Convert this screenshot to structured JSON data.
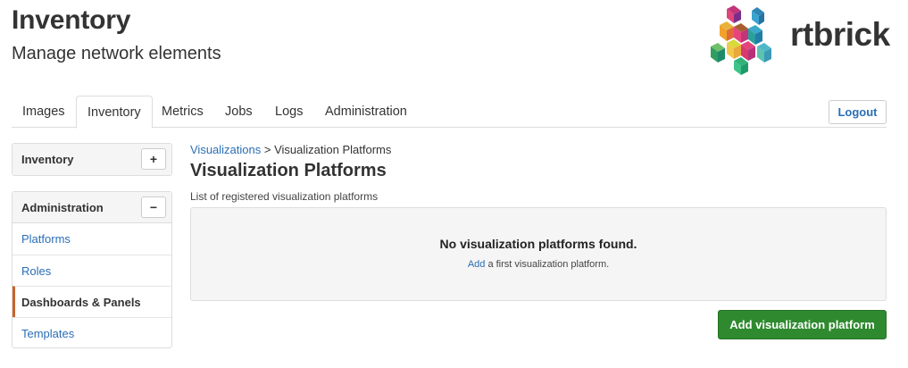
{
  "header": {
    "title": "Inventory",
    "subtitle": "Manage network elements",
    "logo_text": "rtbrick"
  },
  "tabs": [
    {
      "label": "Images",
      "active": false
    },
    {
      "label": "Inventory",
      "active": true
    },
    {
      "label": "Metrics",
      "active": false
    },
    {
      "label": "Jobs",
      "active": false
    },
    {
      "label": "Logs",
      "active": false
    },
    {
      "label": "Administration",
      "active": false
    }
  ],
  "logout_label": "Logout",
  "sidebar": {
    "inventory": {
      "title": "Inventory",
      "toggle": "+"
    },
    "administration": {
      "title": "Administration",
      "toggle": "−",
      "items": [
        {
          "label": "Platforms"
        },
        {
          "label": "Roles"
        },
        {
          "label": "Dashboards & Panels",
          "active": true
        },
        {
          "label": "Templates"
        }
      ]
    }
  },
  "content": {
    "breadcrumb": {
      "link": "Visualizations",
      "separator": ">",
      "current": "Visualization Platforms"
    },
    "title": "Visualization Platforms",
    "description": "List of registered visualization platforms",
    "empty": {
      "title": "No visualization platforms found.",
      "link": "Add",
      "rest": "a first visualization platform."
    },
    "add_button": "Add visualization platform"
  },
  "colors": {
    "link": "#2a6eb5",
    "primary_button": "#2f8a2f",
    "active_accent": "#c8622d"
  }
}
